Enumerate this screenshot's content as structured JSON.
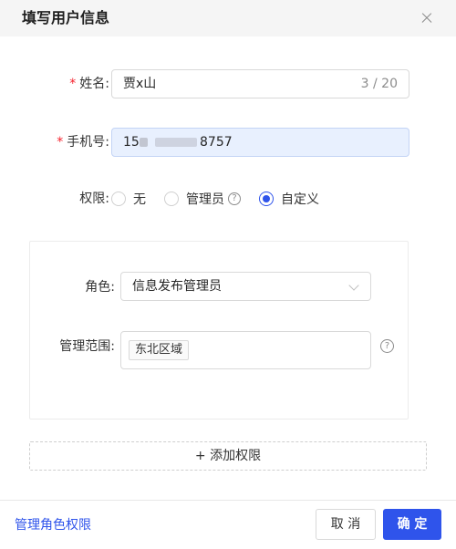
{
  "dialog": {
    "title": "填写用户信息"
  },
  "form": {
    "name_label": "姓名",
    "name_value": "贾x山",
    "name_count": "3 / 20",
    "phone_label": "手机号",
    "phone_prefix": "15",
    "phone_suffix": "8757",
    "permission_label": "权限",
    "permission_options": [
      "无",
      "管理员",
      "自定义"
    ],
    "permission_selected": "自定义"
  },
  "custom": {
    "role_label": "角色",
    "role_value": "信息发布管理员",
    "scope_label": "管理范围",
    "scope_tags": [
      "东北区域"
    ]
  },
  "actions": {
    "add_permission": "+ 添加权限",
    "manage_roles_link": "管理角色权限",
    "cancel": "取 消",
    "confirm": "确 定"
  },
  "colors": {
    "primary": "#2f54eb",
    "required": "#f5222d"
  },
  "icons": {
    "close": "close-icon",
    "help": "question-circle-icon",
    "select": "chevron-down-icon"
  }
}
